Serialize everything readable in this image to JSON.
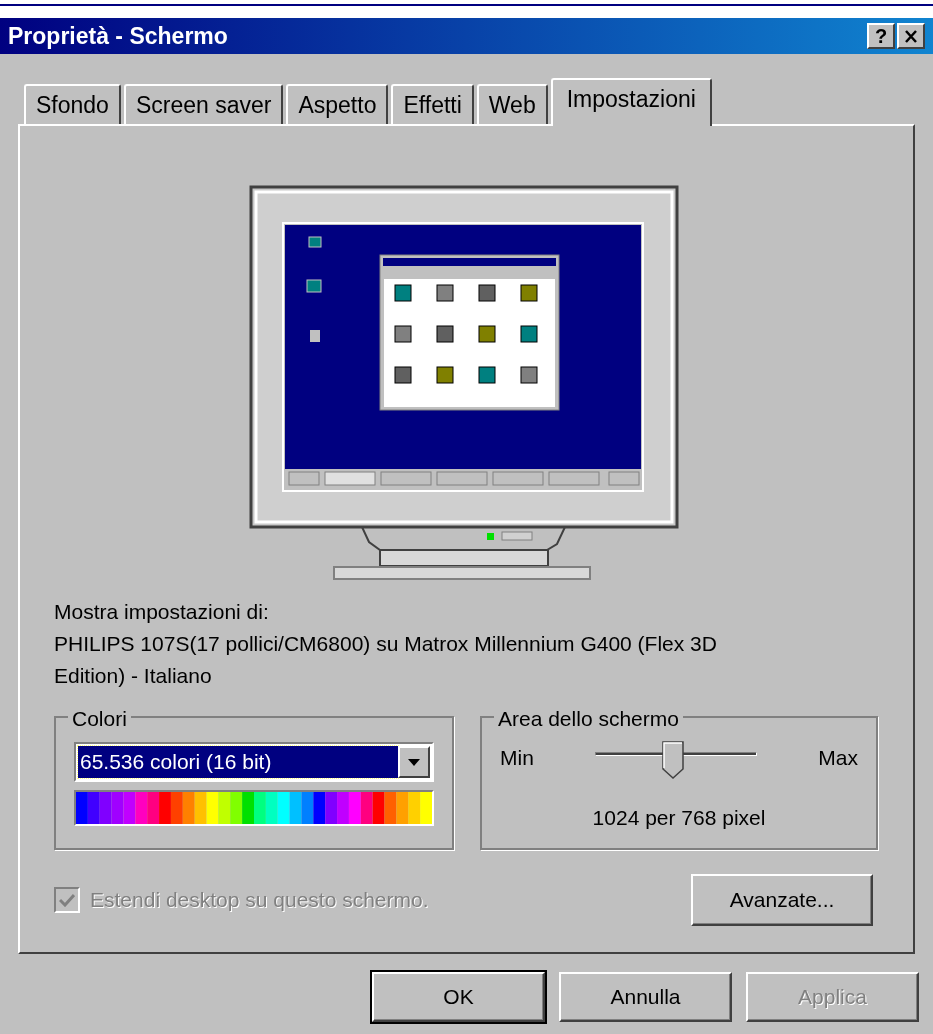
{
  "window": {
    "title": "Proprietà - Schermo",
    "help_button": "?"
  },
  "tabs": [
    {
      "label": "Sfondo",
      "selected": false
    },
    {
      "label": "Screen saver",
      "selected": false
    },
    {
      "label": "Aspetto",
      "selected": false
    },
    {
      "label": "Effetti",
      "selected": false
    },
    {
      "label": "Web",
      "selected": false
    },
    {
      "label": "Impostazioni",
      "selected": true
    }
  ],
  "display_label": "Mostra impostazioni di:",
  "display_name": "PHILIPS 107S(17 pollici/CM6800) su Matrox Millennium G400 (Flex 3D Edition) - Italiano",
  "colors_group": {
    "title": "Colori",
    "dropdown_value": "65.536 colori (16 bit)"
  },
  "area_group": {
    "title": "Area dello schermo",
    "min_label": "Min",
    "max_label": "Max",
    "level": 0.48,
    "reading": "1024 per 768 pixel"
  },
  "checkbox": {
    "label": "Estendi desktop su questo schermo.",
    "checked": true,
    "disabled": true
  },
  "advanced_button": {
    "label": "Avanzate...",
    "disabled": false
  },
  "buttons": [
    {
      "label": "OK",
      "default": true,
      "disabled": false
    },
    {
      "label": "Annulla",
      "default": false,
      "disabled": false
    },
    {
      "label": "Applica",
      "default": false,
      "disabled": true
    }
  ]
}
